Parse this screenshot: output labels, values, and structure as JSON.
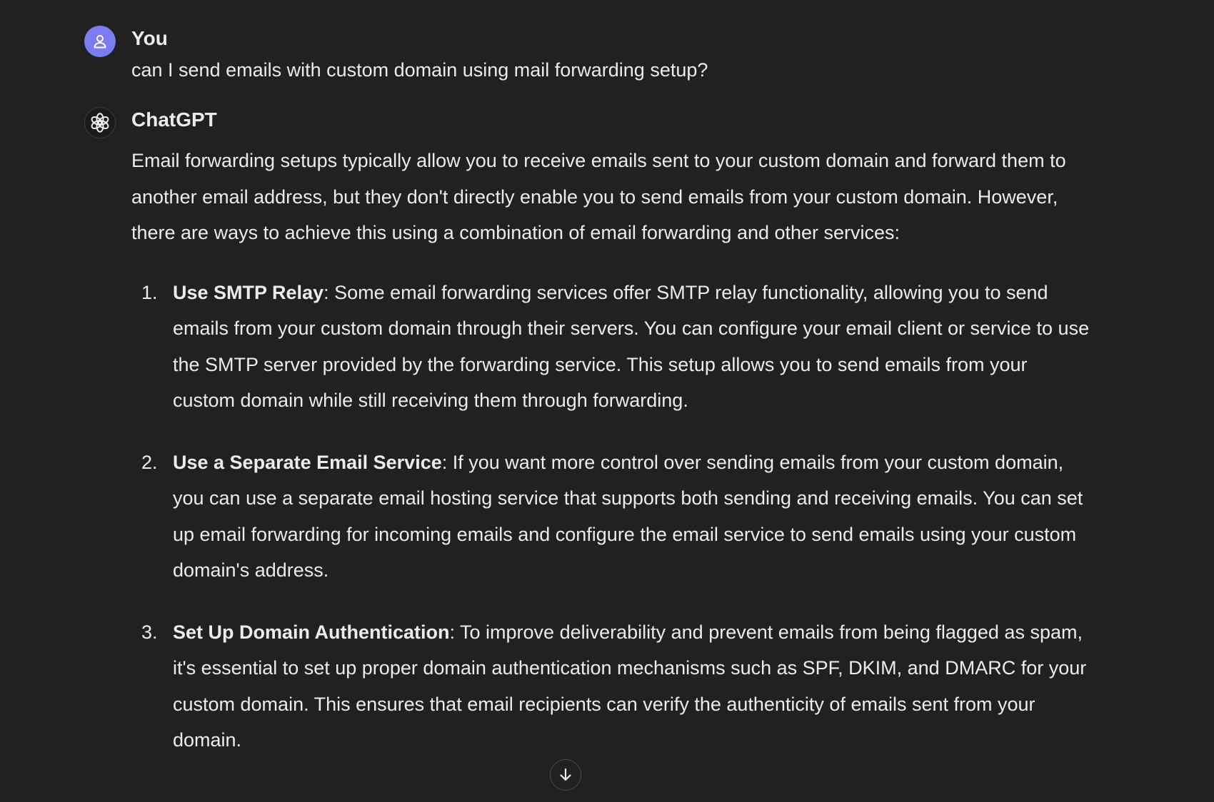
{
  "conversation": {
    "user": {
      "name": "You",
      "message": "can I send emails with custom domain using mail forwarding setup?"
    },
    "assistant": {
      "name": "ChatGPT",
      "intro": "Email forwarding setups typically allow you to receive emails sent to your custom domain and forward them to another email address, but they don't directly enable you to send emails from your custom domain. However, there are ways to achieve this using a combination of email forwarding and other services:",
      "items": [
        {
          "number": "1.",
          "title": "Use SMTP Relay",
          "text": ": Some email forwarding services offer SMTP relay functionality, allowing you to send emails from your custom domain through their servers. You can configure your email client or service to use the SMTP server provided by the forwarding service. This setup allows you to send emails from your custom domain while still receiving them through forwarding."
        },
        {
          "number": "2.",
          "title": "Use a Separate Email Service",
          "text": ": If you want more control over sending emails from your custom domain, you can use a separate email hosting service that supports both sending and receiving emails. You can set up email forwarding for incoming emails and configure the email service to send emails using your custom domain's address."
        },
        {
          "number": "3.",
          "title": "Set Up Domain Authentication",
          "text": ": To improve deliverability and prevent emails from being flagged as spam, it's essential to set up proper domain authentication mechanisms such as SPF, DKIM, and DMARC for your custom domain. This ensures that email recipients can verify the authenticity of emails sent from your domain."
        }
      ]
    }
  },
  "icons": {
    "user_avatar": "user-icon",
    "assistant_avatar": "openai-logo-icon",
    "scroll": "arrow-down-icon"
  },
  "colors": {
    "background": "#212121",
    "text": "#ececec",
    "user_avatar_bg": "#7b7cf0"
  }
}
